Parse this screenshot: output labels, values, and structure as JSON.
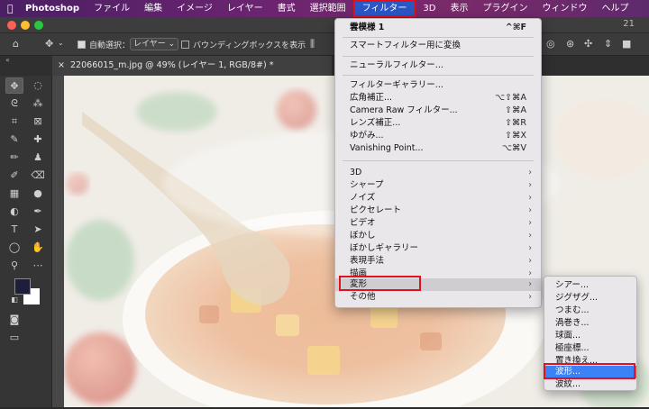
{
  "menubar": {
    "app_name": "Photoshop",
    "items": [
      "ファイル",
      "編集",
      "イメージ",
      "レイヤー",
      "書式",
      "選択範囲",
      "フィルター",
      "3D",
      "表示",
      "プラグイン",
      "ウィンドウ",
      "ヘルプ"
    ]
  },
  "titlebar": {
    "version_suffix": "21"
  },
  "options": {
    "auto_select_label": "自動選択：",
    "auto_select_value": "レイヤー",
    "bounding_box_label": "バウンディングボックスを表示"
  },
  "document_tab": {
    "close": "×",
    "title": "22066015_m.jpg @ 49% (レイヤー 1, RGB/8#) *"
  },
  "panel_collapse": "«",
  "filter_menu": {
    "top": [
      {
        "label": "雲模様 1",
        "shortcut": "^⌘F"
      },
      {
        "label": "スマートフィルター用に変換",
        "shortcut": ""
      },
      {
        "label": "ニューラルフィルター...",
        "shortcut": ""
      },
      {
        "label": "フィルターギャラリー...",
        "shortcut": ""
      },
      {
        "label": "広角補正...",
        "shortcut": "⌥⇧⌘A"
      },
      {
        "label": "Camera Raw フィルター...",
        "shortcut": "⇧⌘A"
      },
      {
        "label": "レンズ補正...",
        "shortcut": "⇧⌘R"
      },
      {
        "label": "ゆがみ...",
        "shortcut": "⇧⌘X"
      },
      {
        "label": "Vanishing Point...",
        "shortcut": "⌥⌘V"
      }
    ],
    "groups": [
      "3D",
      "シャープ",
      "ノイズ",
      "ピクセレート",
      "ビデオ",
      "ぼかし",
      "ぼかしギャラリー",
      "表現手法",
      "描画",
      "変形",
      "その他"
    ],
    "arrow": "›"
  },
  "distort_submenu": [
    "シアー...",
    "ジグザグ...",
    "つまむ...",
    "渦巻き...",
    "球面...",
    "極座標...",
    "置き換え...",
    "波形...",
    "波紋..."
  ],
  "colors": {
    "selection": "#3a82f6",
    "highlight_box": "#e0121b",
    "menubar": "#6b2470"
  }
}
